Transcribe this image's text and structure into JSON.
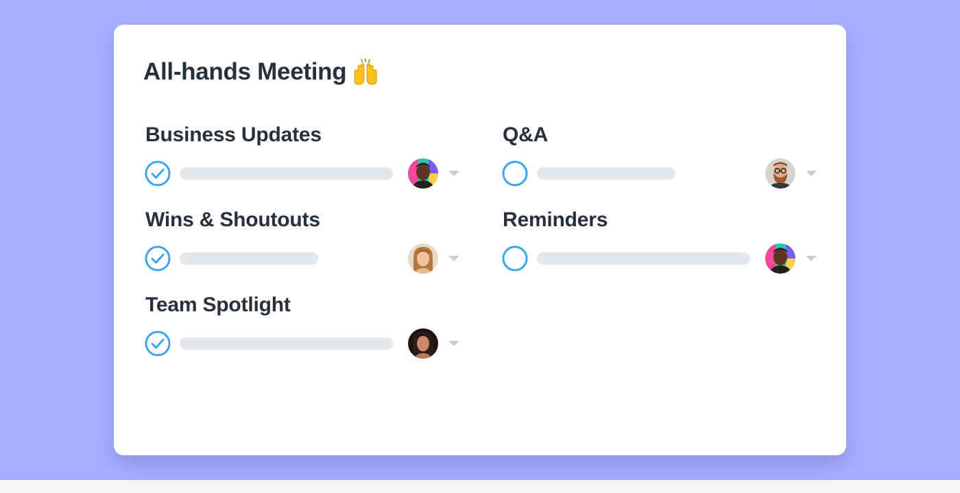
{
  "card": {
    "title": "All-hands Meeting",
    "title_emoji": "raising-hands-emoji"
  },
  "colors": {
    "background": "#a6b0fe",
    "card": "#ffffff",
    "check_accent": "#3ba4f2",
    "placeholder_bar": "#e4e7eb",
    "text": "#25313c",
    "caret": "#c9cdd3"
  },
  "sections": [
    {
      "heading": "Business Updates",
      "completed": true,
      "assignee_icon": "avatar-man-colorful-background",
      "dropdown_icon": "caret-down-icon"
    },
    {
      "heading": "Q&A",
      "completed": false,
      "assignee_icon": "avatar-bearded-man-glasses",
      "dropdown_icon": "caret-down-icon"
    },
    {
      "heading": "Wins & Shoutouts",
      "completed": true,
      "assignee_icon": "avatar-woman-blonde",
      "dropdown_icon": "caret-down-icon"
    },
    {
      "heading": "Reminders",
      "completed": false,
      "assignee_icon": "avatar-man-colorful-background",
      "dropdown_icon": "caret-down-icon"
    },
    {
      "heading": "Team Spotlight",
      "completed": true,
      "assignee_icon": "avatar-woman-dark-hair",
      "dropdown_icon": "caret-down-icon"
    }
  ]
}
